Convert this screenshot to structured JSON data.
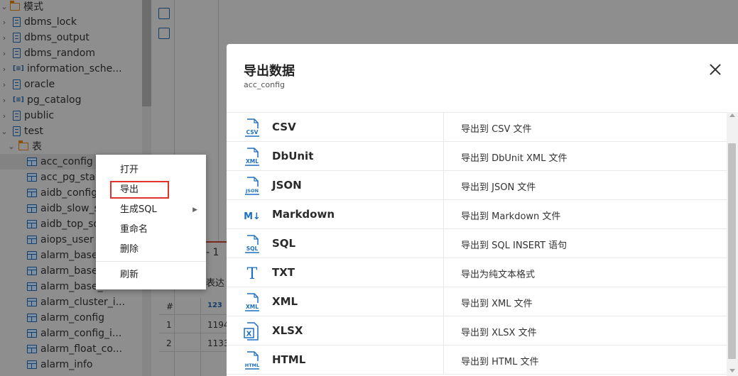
{
  "tree": {
    "root": {
      "label": "模式"
    },
    "schemas": [
      {
        "label": "dbms_lock",
        "icon": "database-icon"
      },
      {
        "label": "dbms_output",
        "icon": "database-icon"
      },
      {
        "label": "dbms_random",
        "icon": "database-icon"
      },
      {
        "label": "information_sche...",
        "icon": "system-schema-icon"
      },
      {
        "label": "oracle",
        "icon": "database-icon"
      },
      {
        "label": "pg_catalog",
        "icon": "system-schema-icon"
      },
      {
        "label": "public",
        "icon": "database-icon"
      },
      {
        "label": "test",
        "icon": "database-icon"
      }
    ],
    "tables_folder": {
      "label": "表"
    },
    "tables": [
      {
        "label": "acc_config"
      },
      {
        "label": "acc_pg_sta"
      },
      {
        "label": "aidb_config"
      },
      {
        "label": "aidb_slow_s"
      },
      {
        "label": "aidb_top_sq"
      },
      {
        "label": "aiops_user"
      },
      {
        "label": "alarm_base"
      },
      {
        "label": "alarm_base"
      },
      {
        "label": "alarm_base_..."
      },
      {
        "label": "alarm_cluster_i..."
      },
      {
        "label": "alarm_config"
      },
      {
        "label": "alarm_config_i..."
      },
      {
        "label": "alarm_float_co..."
      },
      {
        "label": "alarm_info"
      }
    ]
  },
  "background": {
    "pagination": "- 1",
    "expression_label": "表达",
    "grid": {
      "header": {
        "index": "#",
        "col": "123"
      },
      "rows": [
        {
          "index": "1",
          "value": "1194"
        },
        {
          "index": "2",
          "value": "1133"
        }
      ]
    }
  },
  "context_menu": {
    "items": [
      {
        "label": "打开"
      },
      {
        "label": "导出"
      },
      {
        "label": "生成SQL",
        "has_submenu": true
      },
      {
        "label": "重命名"
      },
      {
        "label": "删除"
      },
      {
        "label": "刷新"
      }
    ],
    "highlighted": "导出"
  },
  "dialog": {
    "title": "导出数据",
    "subtitle": "acc_config",
    "formats": [
      {
        "name": "CSV",
        "description": "导出到 CSV 文件",
        "icon": "csv-file-icon",
        "badge": "CSV"
      },
      {
        "name": "DbUnit",
        "description": "导出到 DbUnit XML 文件",
        "icon": "xml-file-icon",
        "badge": "XML"
      },
      {
        "name": "JSON",
        "description": "导出到 JSON 文件",
        "icon": "json-file-icon",
        "badge": "JSON"
      },
      {
        "name": "Markdown",
        "description": "导出到 Markdown 文件",
        "icon": "markdown-icon",
        "badge": "M↓"
      },
      {
        "name": "SQL",
        "description": "导出到 SQL INSERT 语句",
        "icon": "sql-file-icon",
        "badge": "SQL"
      },
      {
        "name": "TXT",
        "description": "导出为纯文本格式",
        "icon": "text-icon",
        "badge": "T"
      },
      {
        "name": "XML",
        "description": "导出到 XML 文件",
        "icon": "xml-file-icon",
        "badge": "XML"
      },
      {
        "name": "XLSX",
        "description": "导出到 XLSX 文件",
        "icon": "xlsx-file-icon",
        "badge": "X"
      },
      {
        "name": "HTML",
        "description": "导出到 HTML 文件",
        "icon": "html-file-icon",
        "badge": "HTML"
      }
    ]
  },
  "colors": {
    "accent": "#1e6fc0",
    "highlight_box": "#e0322a",
    "overlay": "#8e8e8e"
  }
}
